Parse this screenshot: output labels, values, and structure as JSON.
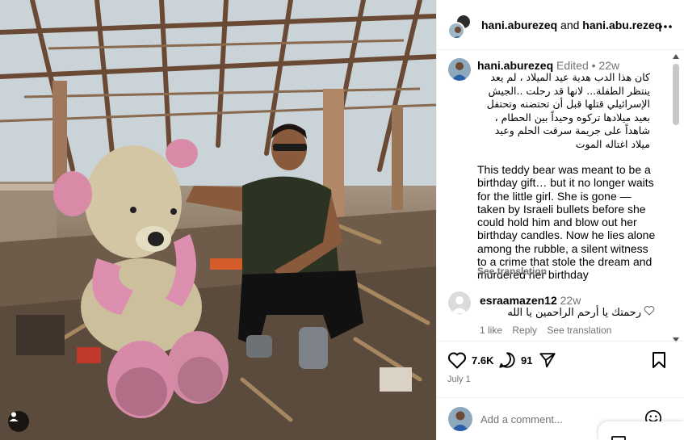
{
  "header": {
    "user1": "hani.aburezeq",
    "connector": "and",
    "user2": "hani.abu.rezeq",
    "more_icon": "more-horizontal-icon"
  },
  "caption": {
    "username": "hani.aburezeq",
    "edited": "Edited",
    "dot": "•",
    "time": "22w",
    "arabic": "كان هذا الدب هدية عيد الميلاد ، لم يعد ينتظر الطفلة... لانها قد رحلت ..الجيش الإسرائيلي قتلها قبل أن تحتضنه وتحتفل بعيد ميلادها  تركوه وحيداً بين الحطام ، شاهداً على جريمة سرقت الحلم وعيد ميلاد اغتاله الموت",
    "english": "This teddy bear was meant to be a birthday gift… but it no longer waits for the little girl. She is gone — taken by Israeli bullets before she could hold him and blow out her birthday candles. Now he lies alone among the rubble, a silent witness to a crime that stole the dream and murdered her birthday",
    "see_translation": "See translation"
  },
  "comment": {
    "username": "esraamazen12",
    "time": "22w",
    "text": "رحمتك يا أرحم الراحمين يا الله",
    "likes": "1 like",
    "reply": "Reply",
    "see_translation": "See translation"
  },
  "actions": {
    "like_count": "7.6K",
    "comment_count": "91",
    "date": "July 1"
  },
  "add_comment": {
    "placeholder": "Add a comment..."
  },
  "colors": {
    "muted": "#737373",
    "border": "#efefef"
  }
}
